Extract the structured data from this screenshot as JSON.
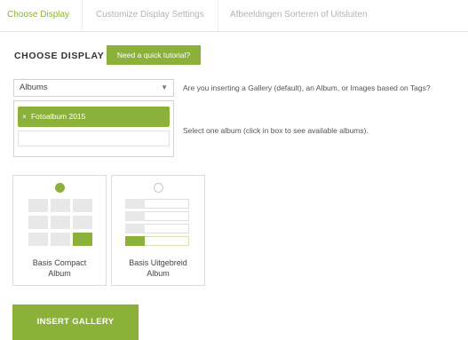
{
  "tabs": [
    {
      "label": "Choose Display",
      "active": true
    },
    {
      "label": "Customize Display Settings",
      "active": false
    },
    {
      "label": "Afbeeldingen Sorteren of Uitsluiten",
      "active": false
    }
  ],
  "section": {
    "heading": "CHOOSE DISPLAY",
    "tutorial_label": "Need a quick tutorial?"
  },
  "source_select": {
    "value": "Albums",
    "caret": "▼",
    "help": "Are you inserting a Gallery (default), an Album, or Images based on Tags?"
  },
  "album_select": {
    "chips": [
      {
        "label": "Fotoalbum 2015",
        "remove_glyph": "×"
      }
    ],
    "help": "Select one album (click in box to see available albums)."
  },
  "display_types": [
    {
      "label_line1": "Basis Compact",
      "label_line2": "Album",
      "selected": true
    },
    {
      "label_line1": "Basis Uitgebreid",
      "label_line2": "Album",
      "selected": false
    }
  ],
  "insert_button": {
    "label": "INSERT GALLERY"
  },
  "colors": {
    "accent": "#8cb13a",
    "tab_inactive": "#b4b4b4",
    "border": "#d3d3d3"
  }
}
